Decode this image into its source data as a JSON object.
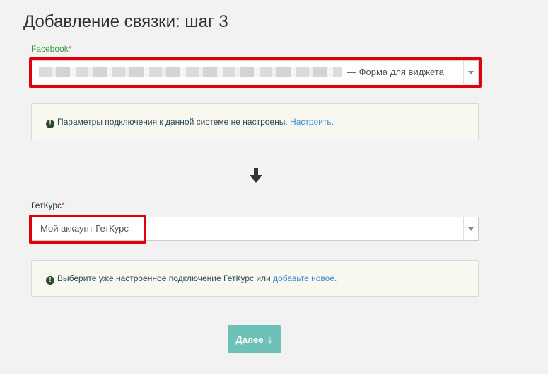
{
  "page": {
    "title": "Добавление связки: шаг 3"
  },
  "source": {
    "label": "Facebook",
    "required_mark": "*",
    "selected_value": "— Форма для виджета",
    "alert": {
      "text": "Параметры подключения к данной системе не настроены.",
      "link": "Настроить."
    }
  },
  "target": {
    "label": "ГетКурс",
    "required_mark": "*",
    "selected_value": "Мой аккаунт ГетКурс",
    "alert": {
      "text": "Выберите уже настроенное подключение ГетКурс или",
      "link": "добавьте новое."
    }
  },
  "actions": {
    "next_label": "Далее",
    "next_arrow": "↓"
  },
  "colors": {
    "background": "#f2f2f2",
    "highlight": "#e0000b",
    "source_label": "#3c9a3c",
    "link": "#3a8fd1",
    "button": "#6ec1b6",
    "alert_bg": "#f8f7f0"
  },
  "icons": {
    "alert": "exclamation-circle-icon",
    "flow": "arrow-down-icon",
    "dropdown": "caret-down-icon"
  }
}
